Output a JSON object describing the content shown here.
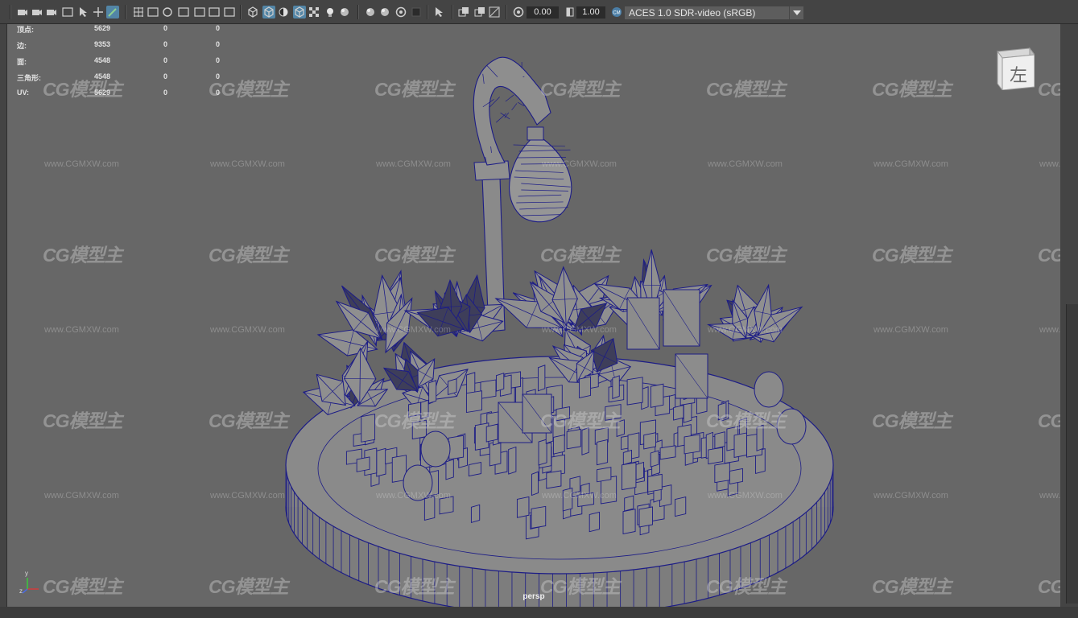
{
  "toolbar": {
    "exposure_value": "0.00",
    "gamma_value": "1.00",
    "color_space": "ACES 1.0 SDR-video (sRGB)",
    "icons": [
      "camera-select-icon",
      "camera-attributes-icon",
      "bookmark-icon",
      "image-plane-icon",
      "2d-pan-zoom-icon",
      "grease-pencil-icon",
      "grid-icon",
      "film-gate-icon",
      "resolution-gate-icon",
      "gate-mask-icon",
      "field-chart-icon",
      "safe-action-icon",
      "safe-title-icon",
      "wireframe-icon",
      "smooth-shade-icon",
      "default-material-icon",
      "wireframe-on-shaded-icon",
      "xray-icon",
      "use-all-lights-icon",
      "shadows-icon",
      "screen-space-ao-icon",
      "motion-blur-icon",
      "multisample-aa-icon",
      "depth-of-field-icon",
      "isolate-select-icon",
      "xray-joints-icon",
      "xray-active-icon",
      "backface-culling-icon",
      "exposure-icon",
      "gamma-icon",
      "color-management-icon"
    ]
  },
  "hud": {
    "rows": [
      {
        "label": "顶点:",
        "value": "5629",
        "selected": "0",
        "component": "0"
      },
      {
        "label": "边:",
        "value": "9353",
        "selected": "0",
        "component": "0"
      },
      {
        "label": "面:",
        "value": "4548",
        "selected": "0",
        "component": "0"
      },
      {
        "label": "三角形:",
        "value": "4548",
        "selected": "0",
        "component": "0"
      },
      {
        "label": "UV:",
        "value": "5629",
        "selected": "0",
        "component": "0"
      }
    ]
  },
  "viewcube": {
    "label": "左"
  },
  "camera": {
    "label": "persp"
  },
  "axis": {
    "x": "x",
    "y": "y",
    "z": "z"
  },
  "watermark": {
    "logo": "CG模型主",
    "url": "www.CGMXW.com"
  },
  "colors": {
    "wire": "#1c1c86",
    "mesh": "#8c8c8c",
    "viewport": "#676767",
    "active": "#5285a6"
  }
}
